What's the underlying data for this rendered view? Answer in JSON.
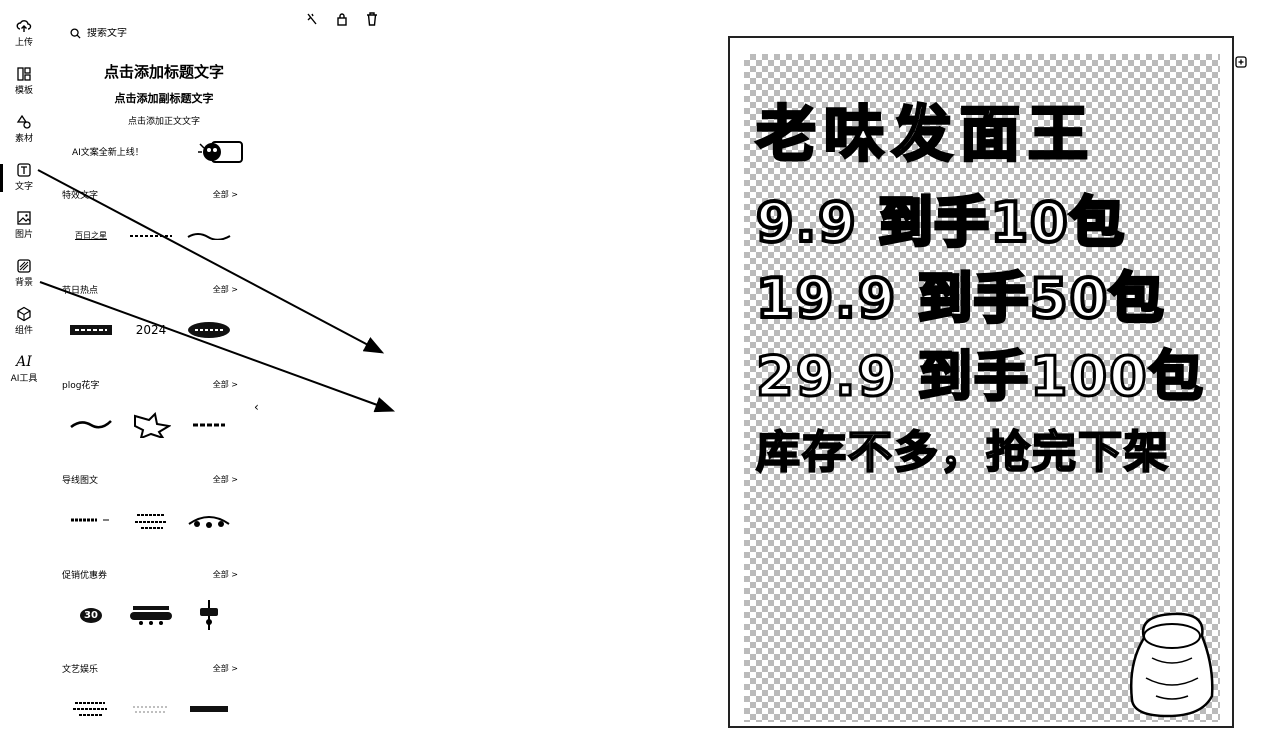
{
  "rail": {
    "items": [
      {
        "label": "上传",
        "icon": "upload-icon"
      },
      {
        "label": "模板",
        "icon": "template-icon"
      },
      {
        "label": "素材",
        "icon": "shapes-icon"
      },
      {
        "label": "文字",
        "icon": "text-icon"
      },
      {
        "label": "图片",
        "icon": "image-icon"
      },
      {
        "label": "背景",
        "icon": "background-icon"
      },
      {
        "label": "组件",
        "icon": "component-icon"
      },
      {
        "label": "AI工具",
        "icon": "ai-icon",
        "glyph": "AI"
      }
    ],
    "active": "文字"
  },
  "panel": {
    "search_placeholder": "搜索文字",
    "add_title": "点击添加标题文字",
    "add_subtitle": "点击添加副标题文字",
    "add_body": "点击添加正文文字",
    "ai_banner": "AI文案全新上线！",
    "more_label": "全部 >",
    "sections": [
      {
        "name": "特效文字",
        "samples": [
          "百日之星",
          "",
          ""
        ]
      },
      {
        "name": "节日热点",
        "samples": [
          "",
          "2024",
          ""
        ]
      },
      {
        "name": "plog花字",
        "samples": [
          "",
          "",
          ""
        ]
      },
      {
        "name": "导线图文",
        "samples": [
          "",
          "",
          ""
        ]
      },
      {
        "name": "促销优惠券",
        "samples": [
          "",
          "30",
          ""
        ]
      },
      {
        "name": "文艺娱乐",
        "samples": [
          "",
          "",
          ""
        ]
      }
    ]
  },
  "poster": {
    "line1": "老味发面王",
    "line2": "9.9 到手10包",
    "line3": "19.9 到手50包",
    "line4": "29.9 到手100包",
    "line5": "库存不多，抢完下架"
  }
}
